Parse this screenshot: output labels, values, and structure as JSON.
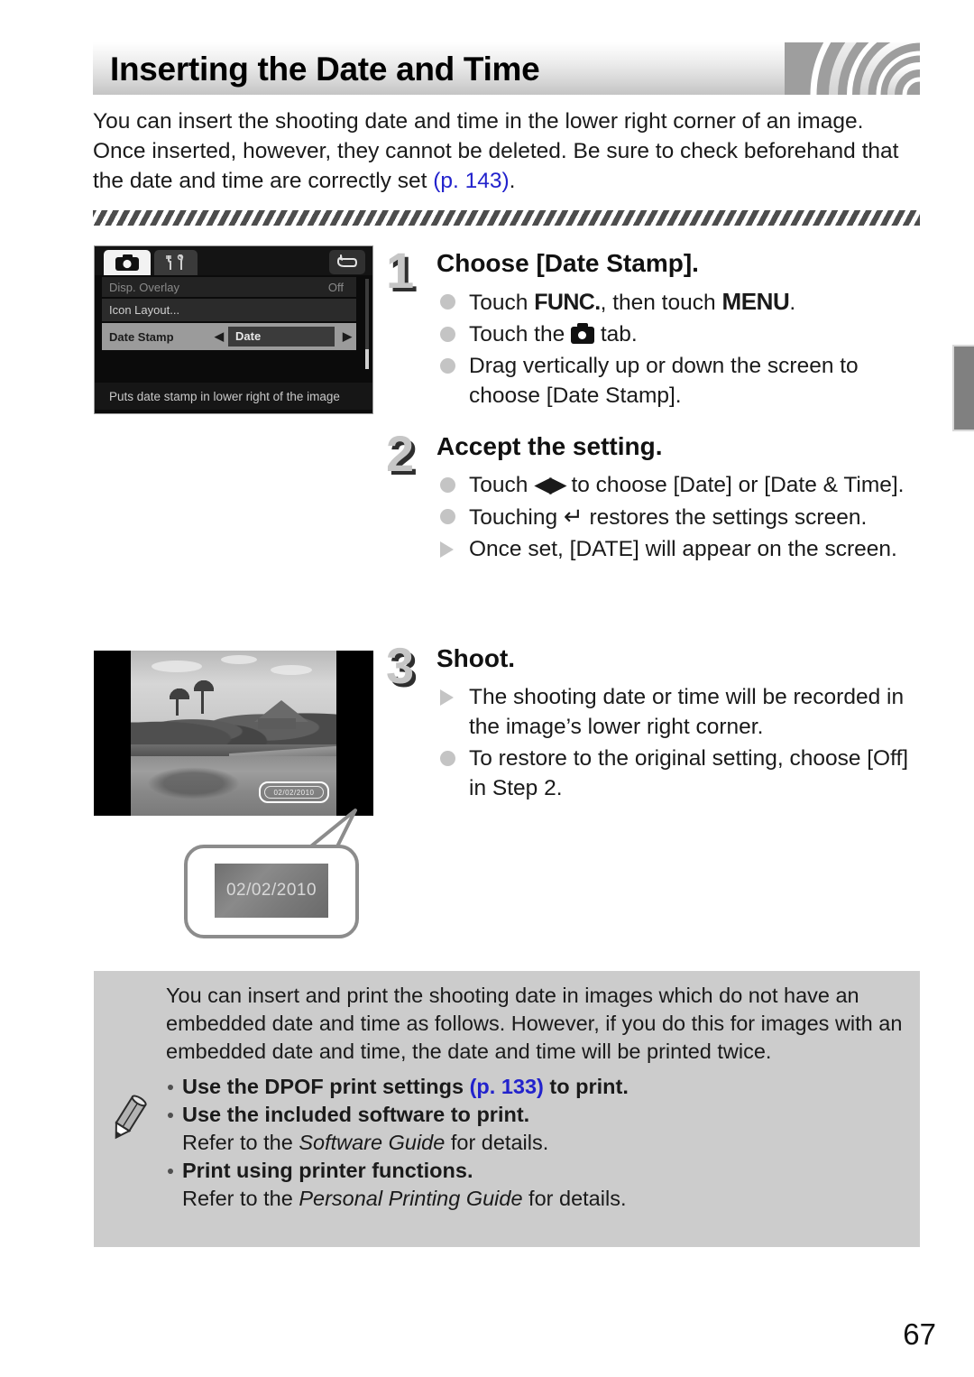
{
  "header": {
    "title": "Inserting the Date and Time"
  },
  "intro": {
    "text_before": "You can insert the shooting date and time in the lower right corner of an image. Once inserted, however, they cannot be deleted. Be sure to check beforehand that the date and time are correctly set ",
    "page_ref": "(p. 143)",
    "text_after": "."
  },
  "lcd_menu": {
    "tabs": [
      "camera-tab",
      "tools-tab"
    ],
    "back_icon": "return-arrow-icon",
    "rows": [
      {
        "label": "Disp. Overlay",
        "value": "Off"
      },
      {
        "label": "Icon Layout...",
        "value": ""
      },
      {
        "label": "Date Stamp",
        "value": "Date",
        "left_arrow": "◀",
        "right_arrow": "▶"
      }
    ],
    "hint": "Puts date stamp in lower right of the image"
  },
  "steps": [
    {
      "number": "1",
      "heading": "Choose [Date Stamp].",
      "lines": [
        {
          "marker": "dot",
          "text_a": "Touch ",
          "glyph": "FUNC.",
          "text_b": ", then touch ",
          "glyph2": "MENU",
          "text_c": "."
        },
        {
          "marker": "dot",
          "text_a": "Touch the ",
          "glyph": "camera-icon",
          "text_b": " tab."
        },
        {
          "marker": "dot",
          "text_a": "Drag vertically up or down the screen to choose [Date Stamp]."
        }
      ]
    },
    {
      "number": "2",
      "heading": "Accept the setting.",
      "lines": [
        {
          "marker": "dot",
          "text_a": "Touch ",
          "glyph": "left-right-arrows-icon",
          "text_b": " to choose [Date] or [Date & Time]."
        },
        {
          "marker": "dot",
          "text_a": "Touching ",
          "glyph": "return-arrow-icon",
          "text_b": " restores the settings screen."
        },
        {
          "marker": "triangle",
          "text_a": "Once set, [DATE] will appear on the screen."
        }
      ]
    },
    {
      "number": "3",
      "heading": "Shoot.",
      "lines": [
        {
          "marker": "triangle",
          "text_a": "The shooting date or time will be recorded in the image’s lower right corner."
        },
        {
          "marker": "dot",
          "text_a": "To restore to the original setting, choose [Off] in Step 2."
        }
      ]
    }
  ],
  "photo": {
    "datestamp_overlay": "02/02/2010",
    "callout_date": "02/02/2010"
  },
  "note": {
    "icon": "pencil-icon",
    "paragraph": "You can insert and print the shooting date in images which do not have an embedded date and time as follows. However, if you do this for images with an embedded date and time, the date and time will be printed twice.",
    "items": [
      {
        "bold_before": "Use the DPOF print settings ",
        "page_ref": "(p. 133)",
        "bold_after": " to print.",
        "sub_before": "",
        "sub_italic": "",
        "sub_after": ""
      },
      {
        "bold_before": "Use the included software to print.",
        "page_ref": "",
        "bold_after": "",
        "sub_before": "Refer to the ",
        "sub_italic": "Software Guide",
        "sub_after": " for details."
      },
      {
        "bold_before": "Print using printer functions.",
        "page_ref": "",
        "bold_after": "",
        "sub_before": "Refer to the ",
        "sub_italic": "Personal Printing Guide",
        "sub_after": " for details."
      }
    ]
  },
  "footer": {
    "page_number": "67"
  },
  "colors": {
    "page_ref_blue": "#2222cc",
    "note_bg": "#cccccc",
    "marker_gray": "#c4c4c4",
    "edge_tab_gray": "#808080"
  }
}
